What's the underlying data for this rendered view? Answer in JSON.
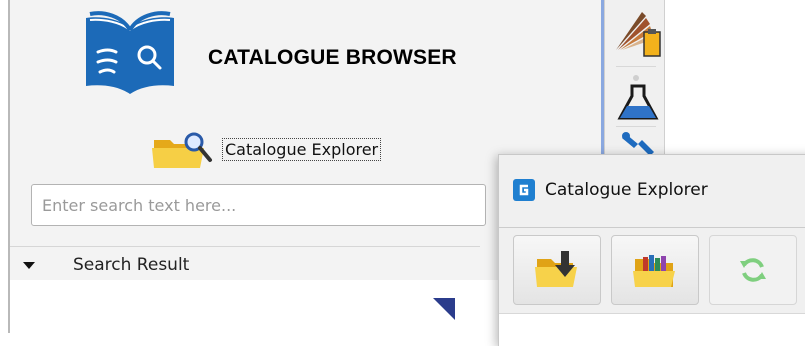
{
  "app": {
    "title": "CATALOGUE BROWSER"
  },
  "explorer_link": {
    "label": "Catalogue Explorer"
  },
  "search": {
    "placeholder": "Enter search text here...",
    "value": ""
  },
  "results": {
    "label": "Search Result",
    "expanded": true
  },
  "side_toolbar": {
    "items": [
      {
        "icon": "color-palette-clipboard-icon"
      },
      {
        "icon": "lab-flask-icon"
      },
      {
        "icon": "wrench-tool-icon"
      }
    ]
  },
  "popup": {
    "title": "Catalogue Explorer",
    "icon": "catalogue-explorer-app-icon",
    "buttons": [
      {
        "icon": "folder-download-icon",
        "enabled": true
      },
      {
        "icon": "folder-books-icon",
        "enabled": true
      },
      {
        "icon": "refresh-icon",
        "enabled": false
      }
    ]
  },
  "colors": {
    "logo_blue": "#1c6ab8",
    "selection_blue": "#8aa8e0",
    "popup_icon_blue": "#1f7fd0",
    "folder_yellow": "#f1c232",
    "refresh_green": "#7fcf7f"
  }
}
